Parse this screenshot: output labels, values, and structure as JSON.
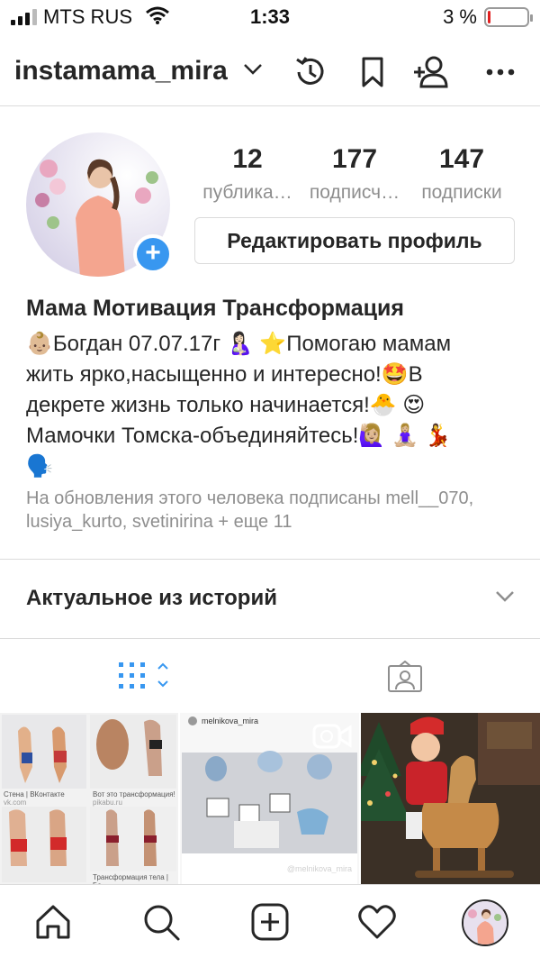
{
  "status_bar": {
    "carrier": "MTS RUS",
    "time": "1:33",
    "battery_percent": "3 %",
    "battery_level": 0.03,
    "battery_color": "#e02020"
  },
  "header": {
    "username": "instamama_mira",
    "icons": [
      "chevron-down-icon",
      "archive-clock-icon",
      "bookmark-icon",
      "discover-people-icon",
      "more-icon"
    ]
  },
  "profile": {
    "stats": [
      {
        "value": "12",
        "label": "публика…"
      },
      {
        "value": "177",
        "label": "подписч…"
      },
      {
        "value": "147",
        "label": "подписки"
      }
    ],
    "edit_button": "Редактировать профиль",
    "add_badge": "+",
    "name": "Мама Мотивация Трансформация",
    "bio": "👶🏼Богдан 07.07.17г 🤱🏻 ⭐Помогаю мамам\nжить ярко,насыщенно и интересно!🤩В\nдекрете жизнь только начинается!🐣 😍\nМамочки Томска-объединяйтесь!🙋🏼‍♀️ 🧘🏼‍♀️ 💃\n🗣️",
    "followed_by": "На обновления этого человека подписаны mell__070, lusiya_kurto, svetinirina + еще 11"
  },
  "highlights": {
    "title": "Актуальное из историй"
  },
  "tabs": [
    "grid-icon",
    "tagged-icon"
  ],
  "posts": [
    {
      "captions": [
        "Стена | ВКонтакте",
        "vk.com",
        "Вот это трансформация!",
        "pikabu.ru",
        "Трансформация тела | Бо..."
      ]
    },
    {
      "account": "melnikova_mira",
      "watermark": "@melnikova_mira",
      "type": "video"
    },
    {
      "type": "photo"
    }
  ],
  "bottom_nav": [
    "home-icon",
    "search-icon",
    "add-post-icon",
    "activity-heart-icon",
    "profile-avatar"
  ],
  "colors": {
    "accent": "#3897f0",
    "text": "#262626",
    "secondary": "#8e8e8e",
    "border": "#dbdbdb"
  }
}
